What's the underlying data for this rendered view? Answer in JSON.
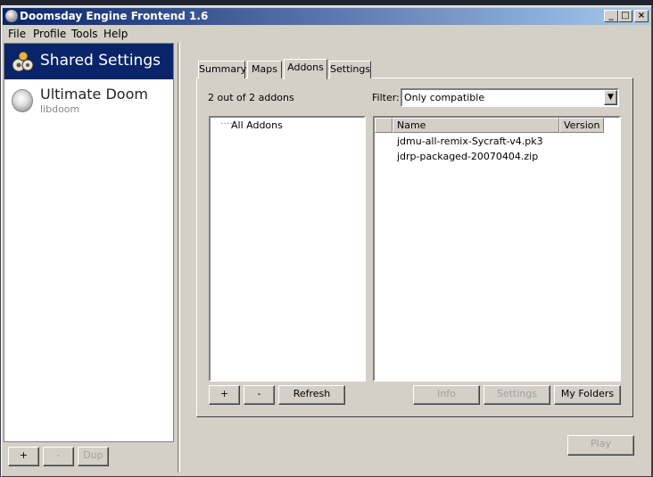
{
  "window": {
    "title": "Doomsday Engine Frontend 1.6"
  },
  "menu": [
    "File",
    "Profile",
    "Tools",
    "Help"
  ],
  "profiles": {
    "shared": "Shared Settings",
    "game_title": "Ultimate Doom",
    "game_sub": "libdoom"
  },
  "left_buttons": {
    "add": "+",
    "remove": "-",
    "dup": "Dup"
  },
  "tabs": [
    "Summary",
    "Maps",
    "Addons",
    "Settings"
  ],
  "addons": {
    "count": "2 out of 2 addons",
    "filter_label": "Filter:",
    "filter_value": "Only compatible",
    "tree_root": "All Addons",
    "columns": [
      "Name",
      "Version"
    ],
    "rows": [
      "jdmu-all-remix-Sycraft-v4.pk3",
      "jdrp-packaged-20070404.zip"
    ],
    "buttons": {
      "add": "+",
      "remove": "-",
      "refresh": "Refresh",
      "info": "Info",
      "settings": "Settings",
      "folders": "My Folders"
    }
  },
  "play": "Play",
  "colors": {
    "titlebar": "#0a246a",
    "face": "#d4d0c8"
  }
}
